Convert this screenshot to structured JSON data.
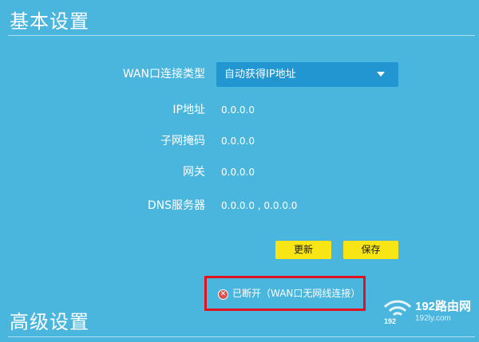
{
  "sections": {
    "basic_title": "基本设置",
    "advanced_title": "高级设置"
  },
  "wan": {
    "type_label": "WAN口连接类型",
    "type_value": "自动获得IP地址"
  },
  "fields": {
    "ip_label": "IP地址",
    "ip_value": "0.0.0.0",
    "mask_label": "子网掩码",
    "mask_value": "0.0.0.0",
    "gateway_label": "网关",
    "gateway_value": "0.0.0.0",
    "dns_label": "DNS服务器",
    "dns_value": "0.0.0.0 , 0.0.0.0"
  },
  "buttons": {
    "refresh": "更新",
    "save": "保存"
  },
  "status": {
    "text": "已断开（WAN口无网线连接）",
    "icon": "x-circle-icon",
    "color": "#e0141c"
  },
  "watermark": {
    "brand": "192路由网",
    "url": "192ly.com",
    "small": "192"
  },
  "colors": {
    "background": "#4ab6de",
    "select_bg": "#2296d0",
    "button_bg": "#f7e515",
    "highlight_border": "#e0141c"
  }
}
